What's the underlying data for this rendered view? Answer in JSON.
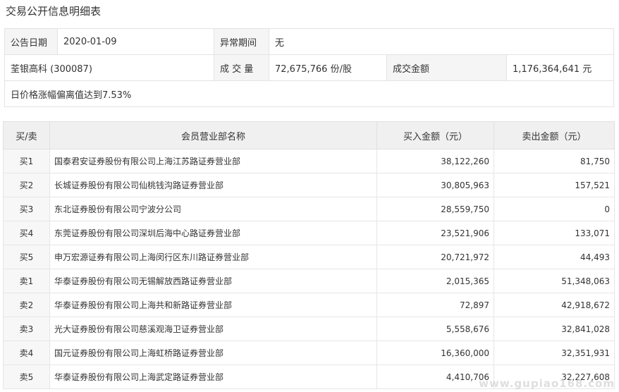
{
  "page": {
    "title": "交易公开信息明细表"
  },
  "info": {
    "announce_date_label": "公告日期",
    "announce_date": "2020-01-09",
    "abnormal_period_label": "异常期间",
    "abnormal_period": "无",
    "stock_name": "荃银高科 (300087)",
    "volume_label": "成 交 量",
    "volume": "72,675,766 份/股",
    "amount_label": "成交金额",
    "amount": "1,176,364,641 元",
    "note": "日价格涨幅偏离值达到7.53%"
  },
  "table": {
    "headers": {
      "side": "买/卖",
      "branch": "会员营业部名称",
      "buy": "买入金额（元）",
      "sell": "卖出金额（元）"
    },
    "rows": [
      {
        "side": "买1",
        "branch": "国泰君安证券股份有限公司上海江苏路证券营业部",
        "buy": "38,122,260",
        "sell": "81,750"
      },
      {
        "side": "买2",
        "branch": "长城证券股份有限公司仙桃钱沟路证券营业部",
        "buy": "30,805,963",
        "sell": "157,521"
      },
      {
        "side": "买3",
        "branch": "东北证券股份有限公司宁波分公司",
        "buy": "28,559,750",
        "sell": "0"
      },
      {
        "side": "买4",
        "branch": "东莞证券股份有限公司深圳后海中心路证券营业部",
        "buy": "23,521,906",
        "sell": "133,071"
      },
      {
        "side": "买5",
        "branch": "申万宏源证券有限公司上海闵行区东川路证券营业部",
        "buy": "20,721,972",
        "sell": "44,493"
      },
      {
        "side": "卖1",
        "branch": "华泰证券股份有限公司无锡解放西路证券营业部",
        "buy": "2,015,365",
        "sell": "51,348,063"
      },
      {
        "side": "卖2",
        "branch": "华泰证券股份有限公司上海共和新路证券营业部",
        "buy": "72,897",
        "sell": "42,918,672"
      },
      {
        "side": "卖3",
        "branch": "光大证券股份有限公司慈溪观海卫证券营业部",
        "buy": "5,558,676",
        "sell": "32,841,028"
      },
      {
        "side": "卖4",
        "branch": "国元证券股份有限公司上海虹桥路证券营业部",
        "buy": "16,360,000",
        "sell": "32,351,931"
      },
      {
        "side": "卖5",
        "branch": "华泰证券股份有限公司上海武定路证券营业部",
        "buy": "4,410,706",
        "sell": "32,227,608"
      }
    ]
  },
  "watermark": "www.gupiao168.com"
}
